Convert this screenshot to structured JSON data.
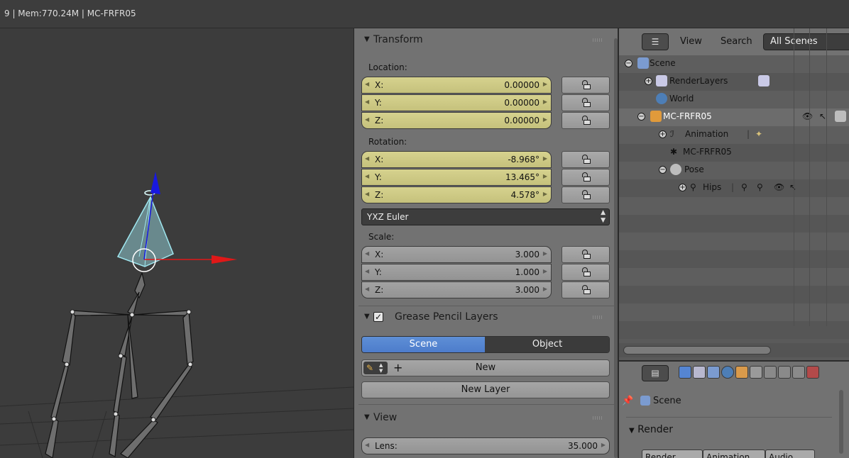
{
  "topbar": {
    "info": "9 | Mem:770.24M | MC-FRFR05"
  },
  "transform": {
    "title": "Transform",
    "location": {
      "label": "Location:",
      "fields": [
        {
          "axis": "X:",
          "value": "0.00000"
        },
        {
          "axis": "Y:",
          "value": "0.00000"
        },
        {
          "axis": "Z:",
          "value": "0.00000"
        }
      ]
    },
    "rotation": {
      "label": "Rotation:",
      "fields": [
        {
          "axis": "X:",
          "value": "-8.968°"
        },
        {
          "axis": "Y:",
          "value": "13.465°"
        },
        {
          "axis": "Z:",
          "value": "4.578°"
        }
      ]
    },
    "rotation_mode": "YXZ Euler",
    "scale": {
      "label": "Scale:",
      "fields": [
        {
          "axis": "X:",
          "value": "3.000"
        },
        {
          "axis": "Y:",
          "value": "1.000"
        },
        {
          "axis": "Z:",
          "value": "3.000"
        }
      ]
    }
  },
  "grease_pencil": {
    "title": "Grease Pencil Layers",
    "tab_scene": "Scene",
    "tab_object": "Object",
    "new_label": "New",
    "new_layer_label": "New Layer"
  },
  "view_panel": {
    "title": "View",
    "lens_label": "Lens:",
    "lens_value": "35.000"
  },
  "outliner": {
    "menu_view": "View",
    "menu_search": "Search",
    "display_mode": "All Scenes",
    "rows": [
      {
        "label": "Scene"
      },
      {
        "label": "RenderLayers"
      },
      {
        "label": "World"
      },
      {
        "label": "MC-FRFR05"
      },
      {
        "label": "Animation"
      },
      {
        "label": "MC-FRFR05"
      },
      {
        "label": "Pose"
      },
      {
        "label": "Hips"
      }
    ]
  },
  "properties_editor": {
    "context": "Scene",
    "panel_title": "Render",
    "buttons": [
      "Render",
      "Animation",
      "Audio"
    ]
  },
  "colors": {
    "selected_field": "#d2ce8a",
    "active_tab": "#5585d2",
    "x_axis": "#e01818",
    "z_axis": "#1818e0",
    "bone_select": "#9fe7f0"
  }
}
